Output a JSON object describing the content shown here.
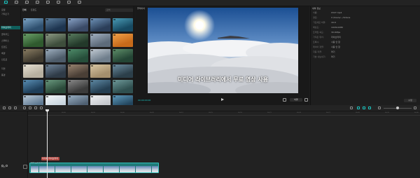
{
  "toolbar": {
    "items": [
      {
        "label": "미디어",
        "active": true
      },
      {
        "label": "오디오",
        "active": false
      },
      {
        "label": "텍스트",
        "active": false
      },
      {
        "label": "스티커",
        "active": false
      },
      {
        "label": "효과",
        "active": false
      },
      {
        "label": "전환",
        "active": false
      },
      {
        "label": "필터",
        "active": false
      },
      {
        "label": "조정",
        "active": false
      }
    ]
  },
  "library": {
    "side_items": [
      {
        "label": "로컬",
        "active": false
      },
      {
        "label": "가져오기",
        "active": false
      },
      {
        "label": "라이브러리",
        "active": true
      },
      {
        "label": "클라우드",
        "active": false
      },
      {
        "label": "스페이스",
        "active": false
      },
      {
        "label": "트렌드",
        "active": false
      },
      {
        "label": "배경",
        "active": false
      },
      {
        "label": "인트로",
        "active": false
      },
      {
        "label": "자연",
        "active": false
      },
      {
        "label": "풍경",
        "active": false
      }
    ],
    "tabs": [
      "전체",
      "트렌드"
    ],
    "search_placeholder": "검색"
  },
  "preview": {
    "title": "플레이어",
    "subtitle": "미디어 라이브러리에서 무료 영상 사용",
    "time": "00:00:00:00",
    "ratio": "비율"
  },
  "details": {
    "title": "세부 정보",
    "rows": [
      {
        "key": "이름:",
        "value": "0327.mp4"
      },
      {
        "key": "경로:",
        "value": "C:/Users/.../Videos"
      },
      {
        "key": "가로세로 비율:",
        "value": "16:9"
      },
      {
        "key": "해상도:",
        "value": "1920x1080"
      },
      {
        "key": "프레임 속도:",
        "value": "30.00fps"
      },
      {
        "key": "가져온 위치:",
        "value": "라이브러리"
      },
      {
        "key": "프록시:",
        "value": "사용 안 함"
      },
      {
        "key": "레이어 정렬:",
        "value": "사용 안 함"
      }
    ],
    "extra_rows": [
      {
        "key": "자동 리플:",
        "value": "켜기"
      },
      {
        "key": "기본 내보내기:",
        "value": "켜기"
      }
    ],
    "button": "수정"
  },
  "timeline": {
    "ticks": [
      "00:00",
      "00:03",
      "00:06",
      "00:09",
      "00:12",
      "00:15",
      "00:18",
      "00:21",
      "00:24",
      "00:27",
      "00:30",
      "00:33",
      "00:36"
    ],
    "text_clip": "미디어 라이브러리",
    "video_clip": "0327.mp4  00:00:12:00",
    "track_label": "커버"
  }
}
